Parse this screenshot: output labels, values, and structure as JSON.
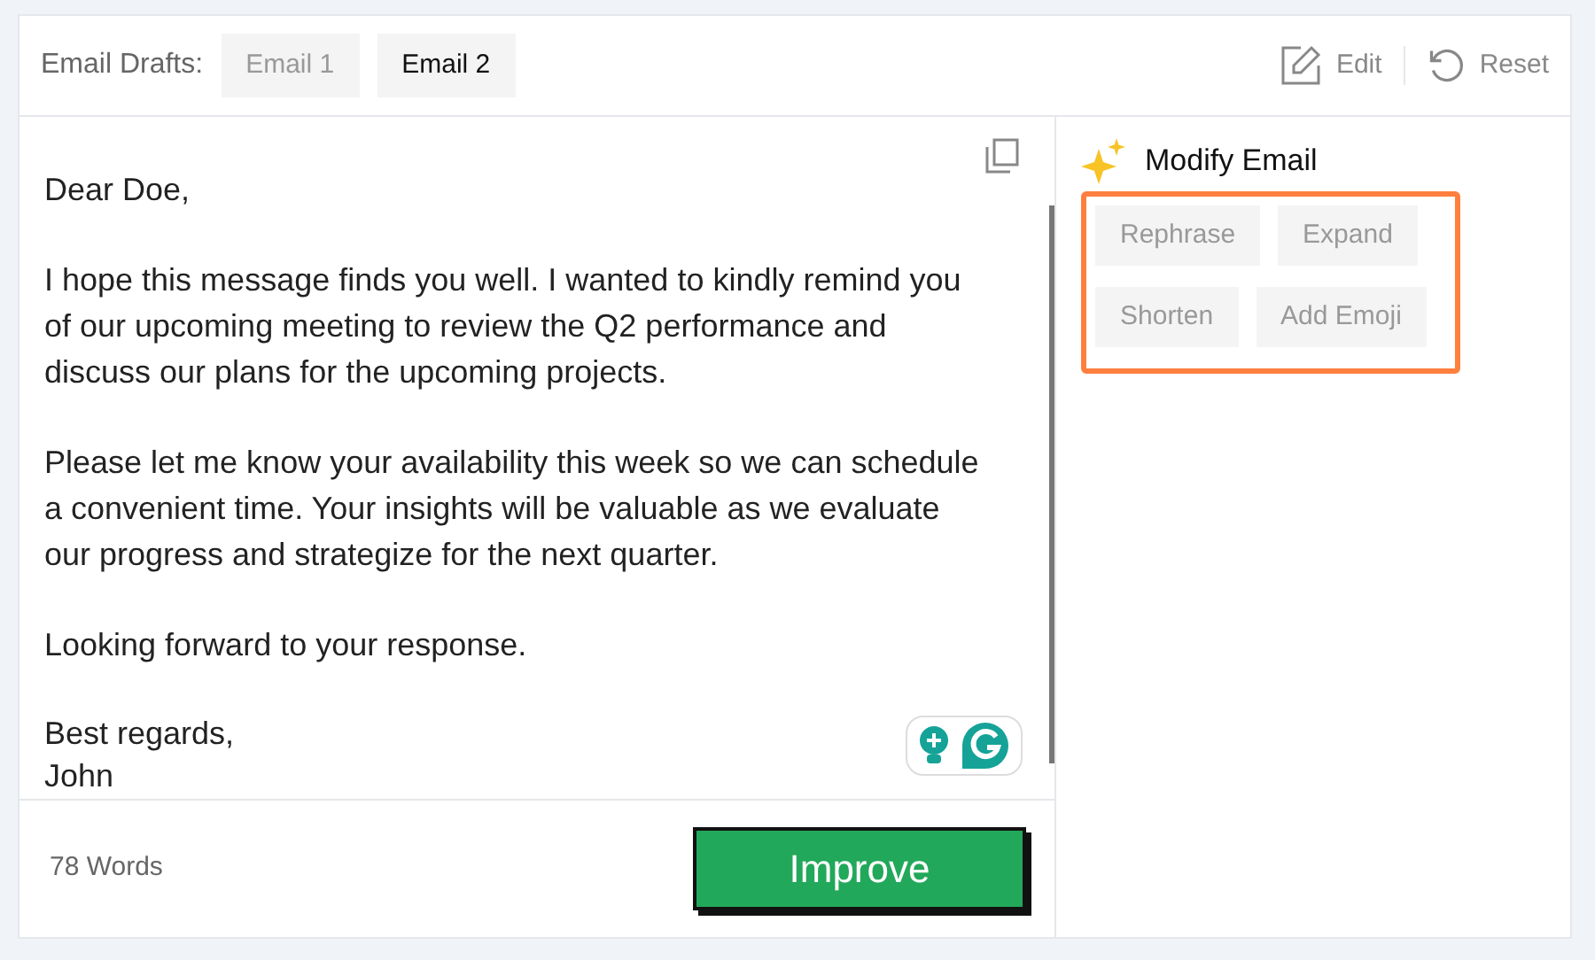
{
  "header": {
    "label": "Email Drafts:",
    "tabs": [
      {
        "label": "Email 1",
        "selected": false
      },
      {
        "label": "Email 2",
        "selected": true
      }
    ],
    "actions": [
      {
        "kind": "edit",
        "label": "Edit"
      },
      {
        "kind": "reset",
        "label": "Reset"
      }
    ]
  },
  "email": {
    "paragraphs": [
      "Dear Doe,",
      "I hope this message finds you well. I wanted to kindly remind you of our upcoming meeting to review the Q2 performance and discuss our plans for the upcoming projects.",
      "Please let me know your availability this week so we can schedule a convenient time. Your insights will be valuable as we evaluate our progress and strategize for the next quarter.",
      "Looking forward to your response."
    ],
    "closing": [
      "Best regards,",
      "John"
    ]
  },
  "footer": {
    "word_count": "78 Words",
    "button": "Improve"
  },
  "modify": {
    "title": "Modify Email",
    "options": [
      "Rephrase",
      "Expand",
      "Shorten",
      "Add Emoji"
    ]
  }
}
